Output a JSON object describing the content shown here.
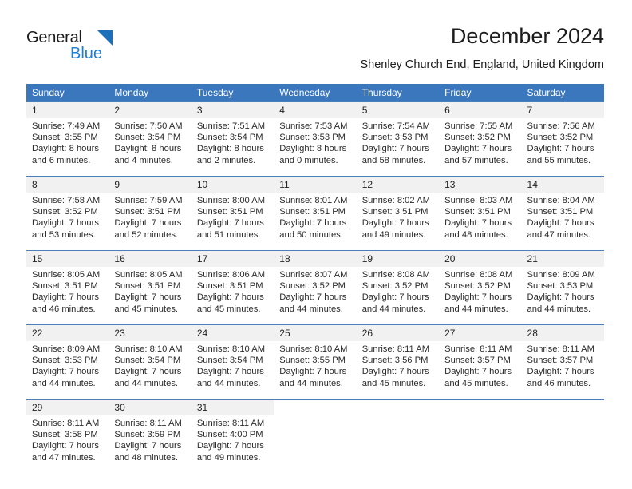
{
  "brand": {
    "name_top": "General",
    "name_bottom": "Blue",
    "color_black": "#1c1c1c",
    "color_blue": "#1c7fd6"
  },
  "header": {
    "title": "December 2024",
    "subtitle": "Shenley Church End, England, United Kingdom"
  },
  "theme": {
    "header_bg": "#3a77bd",
    "header_text": "#ffffff",
    "daynum_bg": "#f1f1f1",
    "row_border": "#4a80b8"
  },
  "calendar": {
    "weekday_headers": [
      "Sunday",
      "Monday",
      "Tuesday",
      "Wednesday",
      "Thursday",
      "Friday",
      "Saturday"
    ],
    "weeks": [
      [
        {
          "day": "1",
          "sunrise": "Sunrise: 7:49 AM",
          "sunset": "Sunset: 3:55 PM",
          "daylight1": "Daylight: 8 hours",
          "daylight2": "and 6 minutes."
        },
        {
          "day": "2",
          "sunrise": "Sunrise: 7:50 AM",
          "sunset": "Sunset: 3:54 PM",
          "daylight1": "Daylight: 8 hours",
          "daylight2": "and 4 minutes."
        },
        {
          "day": "3",
          "sunrise": "Sunrise: 7:51 AM",
          "sunset": "Sunset: 3:54 PM",
          "daylight1": "Daylight: 8 hours",
          "daylight2": "and 2 minutes."
        },
        {
          "day": "4",
          "sunrise": "Sunrise: 7:53 AM",
          "sunset": "Sunset: 3:53 PM",
          "daylight1": "Daylight: 8 hours",
          "daylight2": "and 0 minutes."
        },
        {
          "day": "5",
          "sunrise": "Sunrise: 7:54 AM",
          "sunset": "Sunset: 3:53 PM",
          "daylight1": "Daylight: 7 hours",
          "daylight2": "and 58 minutes."
        },
        {
          "day": "6",
          "sunrise": "Sunrise: 7:55 AM",
          "sunset": "Sunset: 3:52 PM",
          "daylight1": "Daylight: 7 hours",
          "daylight2": "and 57 minutes."
        },
        {
          "day": "7",
          "sunrise": "Sunrise: 7:56 AM",
          "sunset": "Sunset: 3:52 PM",
          "daylight1": "Daylight: 7 hours",
          "daylight2": "and 55 minutes."
        }
      ],
      [
        {
          "day": "8",
          "sunrise": "Sunrise: 7:58 AM",
          "sunset": "Sunset: 3:52 PM",
          "daylight1": "Daylight: 7 hours",
          "daylight2": "and 53 minutes."
        },
        {
          "day": "9",
          "sunrise": "Sunrise: 7:59 AM",
          "sunset": "Sunset: 3:51 PM",
          "daylight1": "Daylight: 7 hours",
          "daylight2": "and 52 minutes."
        },
        {
          "day": "10",
          "sunrise": "Sunrise: 8:00 AM",
          "sunset": "Sunset: 3:51 PM",
          "daylight1": "Daylight: 7 hours",
          "daylight2": "and 51 minutes."
        },
        {
          "day": "11",
          "sunrise": "Sunrise: 8:01 AM",
          "sunset": "Sunset: 3:51 PM",
          "daylight1": "Daylight: 7 hours",
          "daylight2": "and 50 minutes."
        },
        {
          "day": "12",
          "sunrise": "Sunrise: 8:02 AM",
          "sunset": "Sunset: 3:51 PM",
          "daylight1": "Daylight: 7 hours",
          "daylight2": "and 49 minutes."
        },
        {
          "day": "13",
          "sunrise": "Sunrise: 8:03 AM",
          "sunset": "Sunset: 3:51 PM",
          "daylight1": "Daylight: 7 hours",
          "daylight2": "and 48 minutes."
        },
        {
          "day": "14",
          "sunrise": "Sunrise: 8:04 AM",
          "sunset": "Sunset: 3:51 PM",
          "daylight1": "Daylight: 7 hours",
          "daylight2": "and 47 minutes."
        }
      ],
      [
        {
          "day": "15",
          "sunrise": "Sunrise: 8:05 AM",
          "sunset": "Sunset: 3:51 PM",
          "daylight1": "Daylight: 7 hours",
          "daylight2": "and 46 minutes."
        },
        {
          "day": "16",
          "sunrise": "Sunrise: 8:05 AM",
          "sunset": "Sunset: 3:51 PM",
          "daylight1": "Daylight: 7 hours",
          "daylight2": "and 45 minutes."
        },
        {
          "day": "17",
          "sunrise": "Sunrise: 8:06 AM",
          "sunset": "Sunset: 3:51 PM",
          "daylight1": "Daylight: 7 hours",
          "daylight2": "and 45 minutes."
        },
        {
          "day": "18",
          "sunrise": "Sunrise: 8:07 AM",
          "sunset": "Sunset: 3:52 PM",
          "daylight1": "Daylight: 7 hours",
          "daylight2": "and 44 minutes."
        },
        {
          "day": "19",
          "sunrise": "Sunrise: 8:08 AM",
          "sunset": "Sunset: 3:52 PM",
          "daylight1": "Daylight: 7 hours",
          "daylight2": "and 44 minutes."
        },
        {
          "day": "20",
          "sunrise": "Sunrise: 8:08 AM",
          "sunset": "Sunset: 3:52 PM",
          "daylight1": "Daylight: 7 hours",
          "daylight2": "and 44 minutes."
        },
        {
          "day": "21",
          "sunrise": "Sunrise: 8:09 AM",
          "sunset": "Sunset: 3:53 PM",
          "daylight1": "Daylight: 7 hours",
          "daylight2": "and 44 minutes."
        }
      ],
      [
        {
          "day": "22",
          "sunrise": "Sunrise: 8:09 AM",
          "sunset": "Sunset: 3:53 PM",
          "daylight1": "Daylight: 7 hours",
          "daylight2": "and 44 minutes."
        },
        {
          "day": "23",
          "sunrise": "Sunrise: 8:10 AM",
          "sunset": "Sunset: 3:54 PM",
          "daylight1": "Daylight: 7 hours",
          "daylight2": "and 44 minutes."
        },
        {
          "day": "24",
          "sunrise": "Sunrise: 8:10 AM",
          "sunset": "Sunset: 3:54 PM",
          "daylight1": "Daylight: 7 hours",
          "daylight2": "and 44 minutes."
        },
        {
          "day": "25",
          "sunrise": "Sunrise: 8:10 AM",
          "sunset": "Sunset: 3:55 PM",
          "daylight1": "Daylight: 7 hours",
          "daylight2": "and 44 minutes."
        },
        {
          "day": "26",
          "sunrise": "Sunrise: 8:11 AM",
          "sunset": "Sunset: 3:56 PM",
          "daylight1": "Daylight: 7 hours",
          "daylight2": "and 45 minutes."
        },
        {
          "day": "27",
          "sunrise": "Sunrise: 8:11 AM",
          "sunset": "Sunset: 3:57 PM",
          "daylight1": "Daylight: 7 hours",
          "daylight2": "and 45 minutes."
        },
        {
          "day": "28",
          "sunrise": "Sunrise: 8:11 AM",
          "sunset": "Sunset: 3:57 PM",
          "daylight1": "Daylight: 7 hours",
          "daylight2": "and 46 minutes."
        }
      ],
      [
        {
          "day": "29",
          "sunrise": "Sunrise: 8:11 AM",
          "sunset": "Sunset: 3:58 PM",
          "daylight1": "Daylight: 7 hours",
          "daylight2": "and 47 minutes."
        },
        {
          "day": "30",
          "sunrise": "Sunrise: 8:11 AM",
          "sunset": "Sunset: 3:59 PM",
          "daylight1": "Daylight: 7 hours",
          "daylight2": "and 48 minutes."
        },
        {
          "day": "31",
          "sunrise": "Sunrise: 8:11 AM",
          "sunset": "Sunset: 4:00 PM",
          "daylight1": "Daylight: 7 hours",
          "daylight2": "and 49 minutes."
        },
        {
          "day": "",
          "sunrise": "",
          "sunset": "",
          "daylight1": "",
          "daylight2": ""
        },
        {
          "day": "",
          "sunrise": "",
          "sunset": "",
          "daylight1": "",
          "daylight2": ""
        },
        {
          "day": "",
          "sunrise": "",
          "sunset": "",
          "daylight1": "",
          "daylight2": ""
        },
        {
          "day": "",
          "sunrise": "",
          "sunset": "",
          "daylight1": "",
          "daylight2": ""
        }
      ]
    ]
  }
}
